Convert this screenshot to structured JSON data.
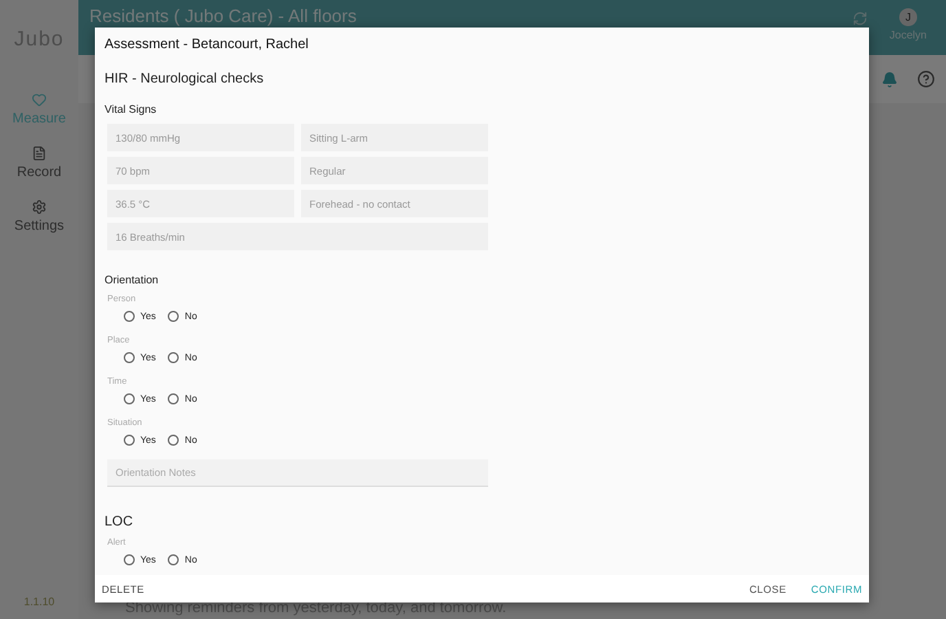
{
  "app": {
    "logo": "Jubo",
    "version": "1.1.10",
    "nav": [
      {
        "label": "Measure",
        "kind": "measure",
        "selected": true
      },
      {
        "label": "Record",
        "kind": "record",
        "selected": false
      },
      {
        "label": "Settings",
        "kind": "settings",
        "selected": false
      }
    ],
    "header": {
      "title": "Residents ( Jubo Care) - All floors",
      "user": {
        "initial": "J",
        "name": "Jocelyn"
      }
    },
    "footer_note": "Showing reminders from yesterday, today, and tomorrow."
  },
  "dialog": {
    "title": "Assessment - Betancourt, Rachel",
    "subtitle": "HIR - Neurological checks",
    "vital_signs": {
      "heading": "Vital Signs",
      "fields": [
        {
          "value": "130/80 mmHg",
          "kind": "half"
        },
        {
          "value": "Sitting L-arm",
          "kind": "half"
        },
        {
          "value": "70 bpm",
          "kind": "half"
        },
        {
          "value": "Regular",
          "kind": "half"
        },
        {
          "value": "36.5 °C",
          "kind": "half"
        },
        {
          "value": "Forehead - no contact",
          "kind": "half"
        },
        {
          "value": "16 Breaths/min",
          "kind": "full"
        }
      ]
    },
    "sections": [
      {
        "heading": "Orientation",
        "kind": "group",
        "questions": [
          {
            "label": "Person",
            "options": [
              {
                "label": "Yes",
                "selected": false
              },
              {
                "label": "No",
                "selected": false
              }
            ]
          },
          {
            "label": "Place",
            "options": [
              {
                "label": "Yes",
                "selected": false
              },
              {
                "label": "No",
                "selected": false
              }
            ]
          },
          {
            "label": "Time",
            "options": [
              {
                "label": "Yes",
                "selected": false
              },
              {
                "label": "No",
                "selected": false
              }
            ]
          },
          {
            "label": "Situation",
            "options": [
              {
                "label": "Yes",
                "selected": false
              },
              {
                "label": "No",
                "selected": false
              }
            ]
          }
        ],
        "notes": {
          "placeholder": "Orientation Notes"
        }
      },
      {
        "heading": "LOC",
        "kind": "section",
        "questions": [
          {
            "label": "Alert",
            "options": [
              {
                "label": "Yes",
                "selected": false
              },
              {
                "label": "No",
                "selected": false
              }
            ]
          }
        ]
      }
    ],
    "actions": {
      "delete": "DELETE",
      "close": "CLOSE",
      "confirm": "CONFIRM"
    }
  }
}
